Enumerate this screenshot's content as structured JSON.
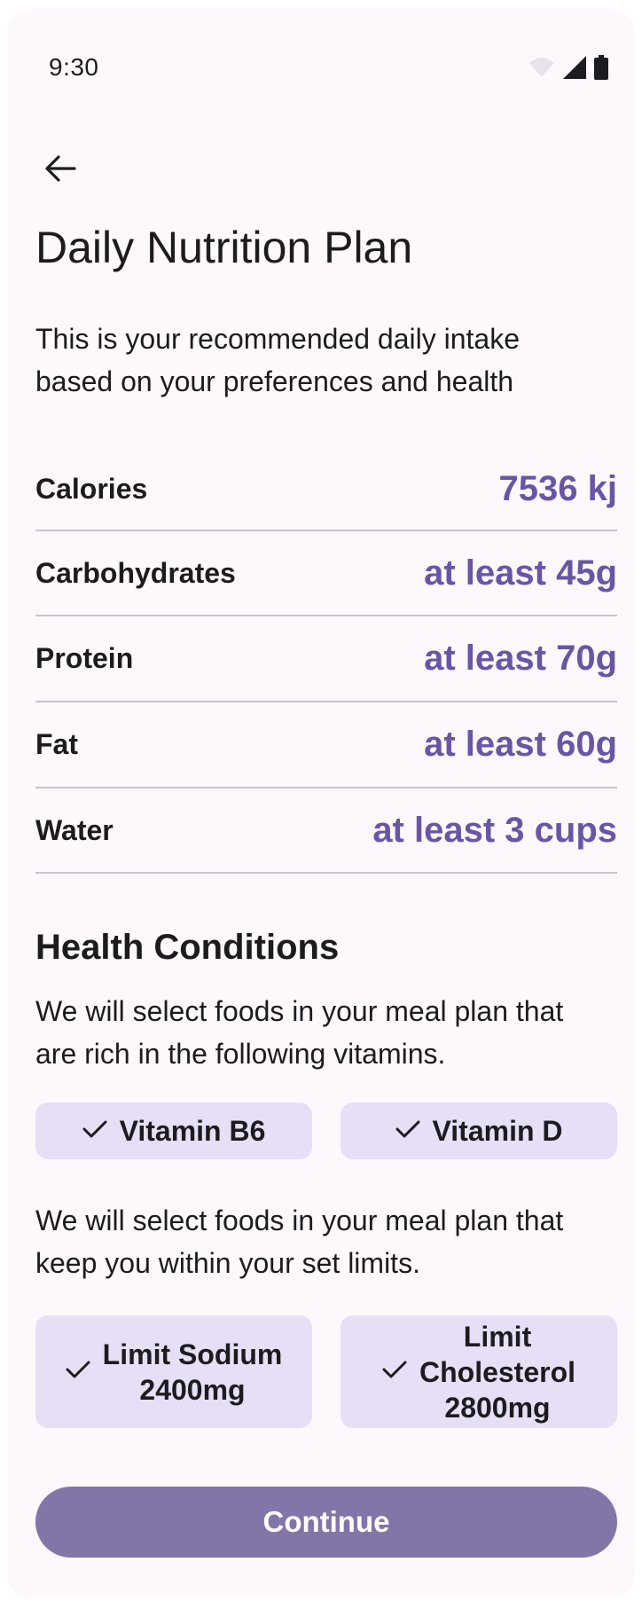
{
  "status_bar": {
    "time": "9:30",
    "icons": [
      "wifi-icon",
      "cellular-signal-icon",
      "battery-icon"
    ]
  },
  "header": {
    "back_icon": "arrow-back-icon",
    "title": "Daily Nutrition Plan"
  },
  "intro": "This is your recommended daily intake based on your preferences and health",
  "nutrients": [
    {
      "label": "Calories",
      "value": "7536 kj"
    },
    {
      "label": "Carbohydrates",
      "value": "at least 45g"
    },
    {
      "label": "Protein",
      "value": "at least 70g"
    },
    {
      "label": "Fat",
      "value": "at least 60g"
    },
    {
      "label": "Water",
      "value": "at least 3 cups"
    }
  ],
  "health": {
    "title": "Health Conditions",
    "vitamins_desc": "We will select foods in your meal plan that are rich in the following vitamins.",
    "vitamins": [
      {
        "label": "Vitamin B6",
        "icon": "check-icon",
        "selected": true
      },
      {
        "label": "Vitamin D",
        "icon": "check-icon",
        "selected": true
      }
    ],
    "limits_desc": "We will select foods in your meal plan that keep you within your set limits.",
    "limits": [
      {
        "lines": [
          "Limit Sodium",
          "2400mg"
        ],
        "icon": "check-icon",
        "selected": true
      },
      {
        "lines": [
          "Limit",
          "Cholesterol",
          "2800mg"
        ],
        "icon": "check-icon",
        "selected": true
      }
    ]
  },
  "continue_label": "Continue",
  "colors": {
    "accent": "#6a55a5",
    "chip_bg": "#e6dff5",
    "button_bg": "#8375a8",
    "surface": "#fdf8fc",
    "divider": "#cac4d0"
  }
}
